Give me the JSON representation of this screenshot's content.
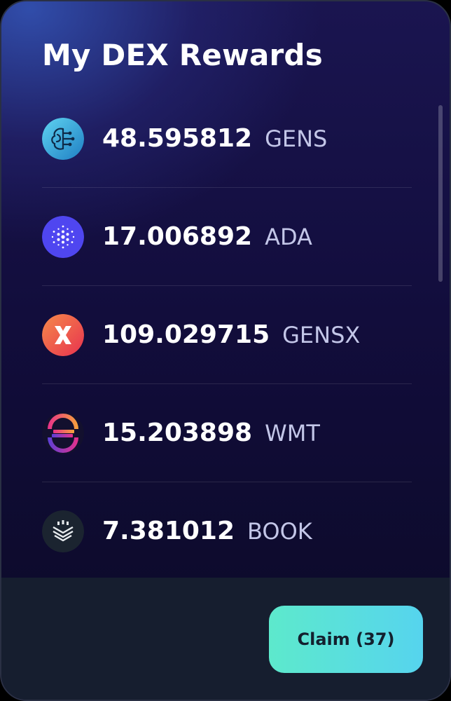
{
  "title": "My DEX Rewards",
  "rewards": [
    {
      "amount": "48.595812",
      "ticker": "GENS",
      "icon": "gens-brain-icon"
    },
    {
      "amount": "17.006892",
      "ticker": "ADA",
      "icon": "ada-cardano-icon"
    },
    {
      "amount": "109.029715",
      "ticker": "GENSX",
      "icon": "gensx-x-icon"
    },
    {
      "amount": "15.203898",
      "ticker": "WMT",
      "icon": "wmt-s-icon"
    },
    {
      "amount": "7.381012",
      "ticker": "BOOK",
      "icon": "book-chevron-icon"
    }
  ],
  "footer": {
    "claim_label": "Claim (37)"
  },
  "colors": {
    "card_top": "#2a3c9a",
    "card_bottom": "#0b0a26",
    "footer_bg": "#161e2f",
    "claim_gradient_start": "#5de9cc",
    "claim_gradient_end": "#56d4ee",
    "ticker_text": "#c3c6e8"
  }
}
